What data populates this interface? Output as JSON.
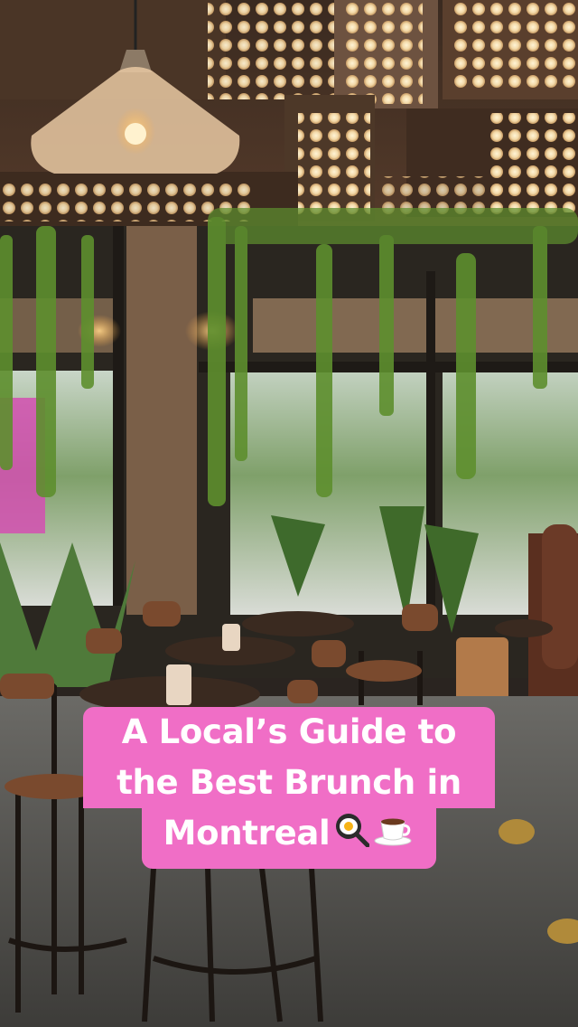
{
  "caption": {
    "line1": "A Local’s Guide to",
    "line2": "the Best Brunch in",
    "line3": "Montreal"
  },
  "icons": [
    "frying-pan-egg-icon",
    "coffee-cup-icon"
  ],
  "colors": {
    "caption_bg": "#f06ec6",
    "caption_text": "#ffffff"
  }
}
